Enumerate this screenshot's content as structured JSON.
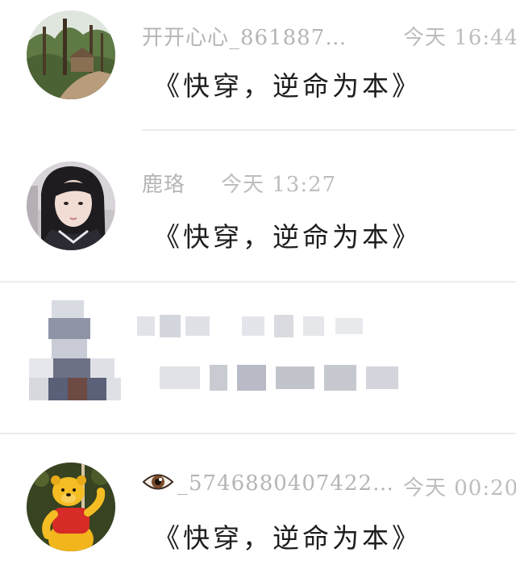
{
  "comments": [
    {
      "username": "开开心心_861887…",
      "time": "今天 16:44",
      "message": "《快穿，逆命为本》",
      "avatar": "forest-photo"
    },
    {
      "username": "鹿珞",
      "time": "今天 13:27",
      "message": "《快穿，逆命为本》",
      "avatar": "girl-portrait"
    },
    {
      "username": "",
      "time": "",
      "message": "",
      "avatar": "pixelated-censored"
    },
    {
      "username": "_5746880407422…",
      "time": "今天 00:20",
      "message": "《快穿，逆命为本》",
      "avatar": "winnie-the-pooh",
      "username_prefix_icon": "eye-icon"
    }
  ]
}
